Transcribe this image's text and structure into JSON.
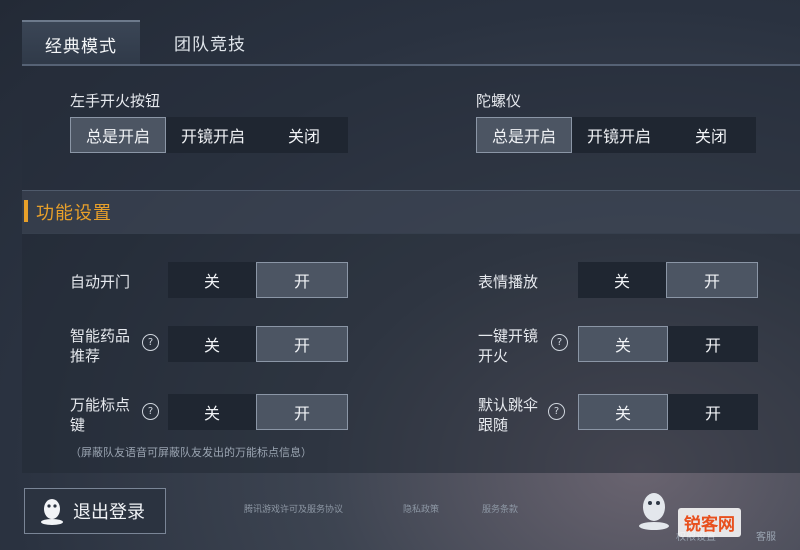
{
  "tabs": [
    {
      "label": "经典模式",
      "active": true
    },
    {
      "label": "团队竞技",
      "active": false
    }
  ],
  "top": {
    "left_fire": {
      "label": "左手开火按钮",
      "options": [
        "总是开启",
        "开镜开启",
        "关闭"
      ],
      "selected": "总是开启"
    },
    "gyro": {
      "label": "陀螺仪",
      "options": [
        "总是开启",
        "开镜开启",
        "关闭"
      ],
      "selected": "总是开启"
    }
  },
  "section_title": "功能设置",
  "settings": {
    "auto_door": {
      "label": "自动开门",
      "off": "关",
      "on": "开",
      "selected": "开"
    },
    "emote": {
      "label": "表情播放",
      "off": "关",
      "on": "开",
      "selected": "开"
    },
    "smart_med": {
      "label_1": "智能药品",
      "label_2": "推荐",
      "help": "?",
      "off": "关",
      "on": "开",
      "selected": "开"
    },
    "one_key": {
      "label_1": "一键开镜",
      "label_2": "开火",
      "help": "?",
      "off": "关",
      "on": "开",
      "selected": "关"
    },
    "marker": {
      "label_1": "万能标点",
      "label_2": "键",
      "help": "?",
      "off": "关",
      "on": "开",
      "selected": "开"
    },
    "follow": {
      "label_1": "默认跳伞",
      "label_2": "跟随",
      "help": "?",
      "off": "关",
      "on": "开",
      "selected": "关"
    }
  },
  "note": "（屏蔽队友语音可屏蔽队友发出的万能标点信息）",
  "footer": {
    "logout": "退出登录",
    "links": [
      "腾讯游戏许可及服务协议",
      "隐私政策",
      "服务条款"
    ],
    "small": [
      "权限设置",
      "客服"
    ],
    "brand": "锐客网"
  },
  "colors": {
    "accent": "#e8a02a",
    "selected_bg": "#4c5563",
    "unselected_bg": "#1f2631"
  }
}
